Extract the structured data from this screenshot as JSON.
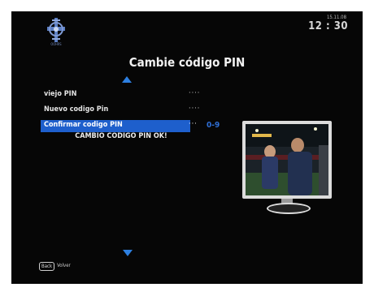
{
  "header": {
    "logo_caption": "OOHRS",
    "date": "15.11.08",
    "time": "12 : 30"
  },
  "menu": {
    "title": "Cambie código PIN",
    "rows": [
      {
        "label": "viejo PIN",
        "value": "····"
      },
      {
        "label": "Nuevo codigo Pin",
        "value": "····"
      },
      {
        "label": "Confirmar codigo PIN",
        "value": "···"
      }
    ],
    "input_hint": "0-9",
    "status_message": "CAMBIO CODIGO PIN OK!"
  },
  "footer": {
    "back_key": "Back",
    "back_label": "Volver"
  },
  "colors": {
    "background": "#060606",
    "highlight": "#1e5fcc",
    "arrow": "#2d7fe0"
  }
}
